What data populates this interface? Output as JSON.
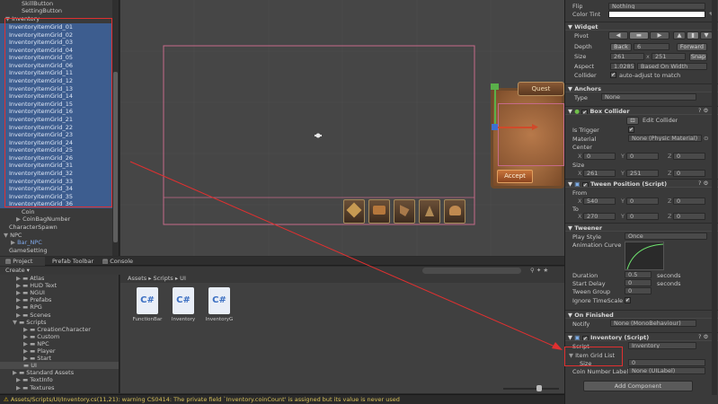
{
  "hierarchy": {
    "top_items": [
      "SkillButton",
      "SettingButton"
    ],
    "inventory_label": "Inventory",
    "selected_items": [
      "InventoryItemGrid_01",
      "InventoryItemGrid_02",
      "InventoryItemGrid_03",
      "InventoryItemGrid_04",
      "InventoryItemGrid_05",
      "InventoryItemGrid_06",
      "InventoryItemGrid_11",
      "InventoryItemGrid_12",
      "InventoryItemGrid_13",
      "InventoryItemGrid_14",
      "InventoryItemGrid_15",
      "InventoryItemGrid_16",
      "InventoryItemGrid_21",
      "InventoryItemGrid_22",
      "InventoryItemGrid_23",
      "InventoryItemGrid_24",
      "InventoryItemGrid_25",
      "InventoryItemGrid_26",
      "InventoryItemGrid_31",
      "InventoryItemGrid_32",
      "InventoryItemGrid_33",
      "InventoryItemGrid_34",
      "InventoryItemGrid_35",
      "InventoryItemGrid_36"
    ],
    "after_items": [
      "Coin",
      "CoinBagNumber",
      "CharacterSpawn",
      "NPC",
      "Bar_NPC",
      "GameSetting"
    ]
  },
  "bottom_tabs": [
    "Project",
    "Prefab Toolbar",
    "Console"
  ],
  "create_label": "Create",
  "project_tree": [
    "Atlas",
    "HUD Text",
    "NGUI",
    "Prefabs",
    "RPG",
    "Scenes",
    "Scripts",
    "CreationCharacter",
    "Custom",
    "NPC",
    "Player",
    "Start",
    "UI",
    "Standard Assets",
    "TextInfo",
    "Textures"
  ],
  "breadcrumb": "Assets ▸ Scripts ▸ UI",
  "files": [
    "FunctionBar",
    "Inventory",
    "InventoryG"
  ],
  "status_message": "Assets/Scripts/UI/Inventory.cs(11,21): warning CS0414: The private field `Inventory.coinCount' is assigned but its value is never used",
  "scene": {
    "quest_title": "Quest",
    "accept_label": "Accept"
  },
  "inspector": {
    "flip_label": "Flip",
    "flip_value": "Nothing",
    "color_tint_label": "Color Tint",
    "widget_header": "Widget",
    "pivot_label": "Pivot",
    "depth_label": "Depth",
    "back_label": "Back",
    "depth_value": "6",
    "forward_label": "Forward",
    "size_label": "Size",
    "size_w": "261",
    "size_h": "251",
    "snap_label": "Snap",
    "aspect_label": "Aspect",
    "aspect_value": "1.02857",
    "aspect_mode": "Based On Width",
    "collider_label": "Collider",
    "collider_text": "auto-adjust to match",
    "anchors_header": "Anchors",
    "anchors_type_label": "Type",
    "anchors_type_value": "None",
    "box_collider_header": "Box Collider",
    "edit_collider": "Edit Collider",
    "is_trigger_label": "Is Trigger",
    "material_label": "Material",
    "material_value": "None (Physic Material)",
    "center_label": "Center",
    "center": [
      "0",
      "0",
      "0"
    ],
    "bsize_label": "Size",
    "bsize": [
      "261",
      "251",
      "0"
    ],
    "tween_header": "Tween Position (Script)",
    "from_label": "From",
    "from": [
      "540",
      "0",
      "0"
    ],
    "to_label": "To",
    "to": [
      "270",
      "0",
      "0"
    ],
    "tweener_header": "Tweener",
    "play_style_label": "Play Style",
    "play_style_value": "Once",
    "curve_label": "Animation Curve",
    "duration_label": "Duration",
    "duration_value": "0.5",
    "seconds": "seconds",
    "start_delay_label": "Start Delay",
    "start_delay_value": "0",
    "tween_group_label": "Tween Group",
    "tween_group_value": "0",
    "ignore_ts_label": "Ignore TimeScale",
    "on_finished_header": "On Finished",
    "notify_label": "Notify",
    "notify_value": "None (MonoBehaviour)",
    "inventory_script_header": "Inventory (Script)",
    "script_label": "Script",
    "script_value": "Inventory",
    "item_grid_label": "Item Grid List",
    "grid_size_label": "Size",
    "grid_size_value": "0",
    "coin_label": "Coin Number Label",
    "coin_value": "None (UILabel)",
    "add_component": "Add Component"
  },
  "colors": {
    "selection": "#3d5d8f",
    "highlight_red": "#e03030",
    "scene_bg": "#464646",
    "panel_bg": "#3a3a3a"
  }
}
